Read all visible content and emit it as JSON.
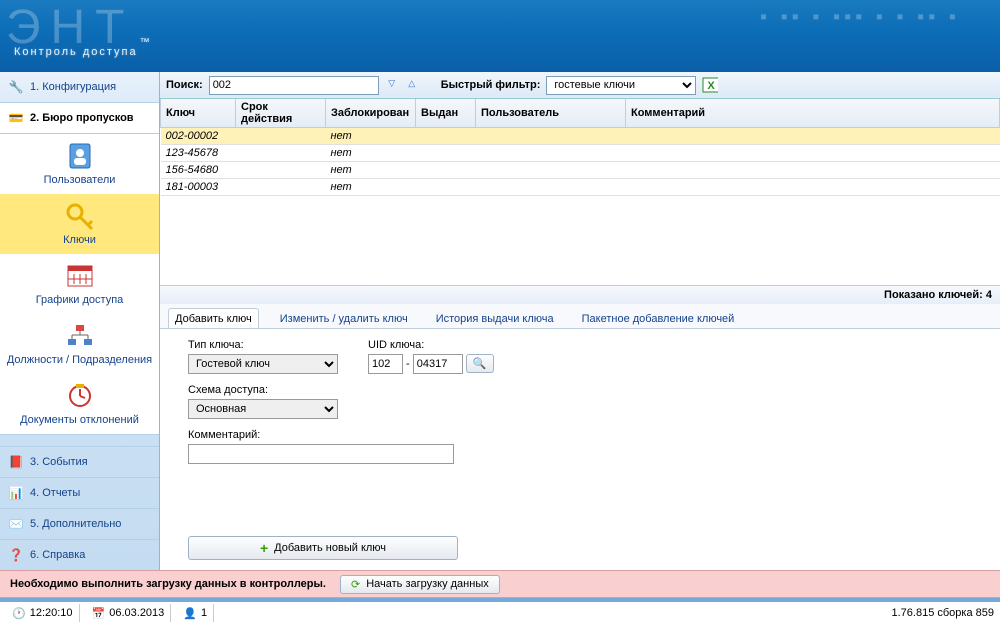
{
  "app_title": "Контроль доступа",
  "nav": {
    "config": "1. Конфигурация",
    "bureau": "2. Бюро пропусков",
    "events": "3. События",
    "reports": "4. Отчеты",
    "extra": "5. Дополнительно",
    "help": "6. Справка"
  },
  "sub_nav": {
    "users": "Пользователи",
    "keys": "Ключи",
    "schedules": "Графики доступа",
    "positions": "Должности / Подразделения",
    "deviations": "Документы отклонений"
  },
  "search": {
    "label": "Поиск:",
    "value": "002",
    "filter_label": "Быстрый фильтр:",
    "filter_value": "гостевые ключи"
  },
  "grid": {
    "cols": {
      "key": "Ключ",
      "expiry": "Срок действия",
      "blocked": "Заблокирован",
      "issued": "Выдан",
      "user": "Пользователь",
      "comment": "Комментарий"
    },
    "rows": [
      {
        "key": "002-00002",
        "blocked": "нет"
      },
      {
        "key": "123-45678",
        "blocked": "нет"
      },
      {
        "key": "156-54680",
        "blocked": "нет"
      },
      {
        "key": "181-00003",
        "blocked": "нет"
      }
    ],
    "footer": "Показано ключей: 4"
  },
  "tabs": {
    "add": "Добавить ключ",
    "edit": "Изменить / удалить ключ",
    "history": "История выдачи ключа",
    "batch": "Пакетное добавление ключей"
  },
  "form": {
    "type_label": "Тип ключа:",
    "type_value": "Гостевой ключ",
    "uid_label": "UID ключа:",
    "uid_a": "102",
    "uid_b": "04317",
    "scheme_label": "Схема доступа:",
    "scheme_value": "Основная",
    "comment_label": "Комментарий:",
    "comment_value": "",
    "add_btn": "Добавить новый ключ"
  },
  "warning": {
    "text": "Необходимо выполнить загрузку данных в контроллеры.",
    "btn": "Начать загрузку данных"
  },
  "status": {
    "time": "12:20:10",
    "date": "06.03.2013",
    "users": "1",
    "build": "1.76.815 сборка 859"
  }
}
